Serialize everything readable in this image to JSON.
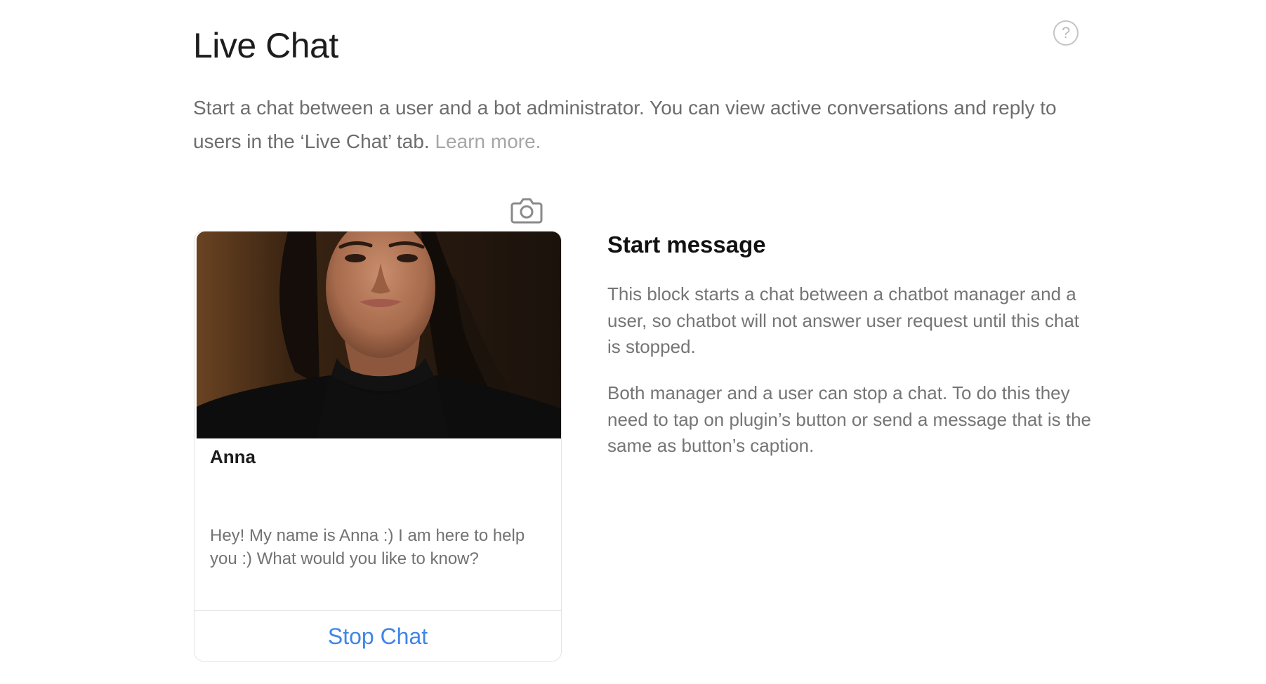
{
  "header": {
    "title": "Live Chat",
    "help_icon": "question-circle-icon",
    "help_glyph": "?"
  },
  "intro": {
    "text": "Start a chat between a user and a bot administrator. You can view active conversations and reply to users in the ‘Live Chat’ tab. ",
    "learn_more": "Learn more."
  },
  "card": {
    "camera_icon": "camera-icon",
    "image": "portrait-photo",
    "name": "Anna",
    "message": "Hey! My name is Anna :) I am here to help you :) What would you like to know?",
    "button_label": "Stop Chat"
  },
  "side": {
    "title": "Start message",
    "paragraph1": "This block starts a chat between a chatbot manager and a user, so chatbot will not answer user request until this chat is stopped.",
    "paragraph2": "Both manager and a user can stop a chat. To do this they need to tap on plugin’s button or send a message that is the same as button’s caption."
  },
  "colors": {
    "accent": "#3f86e6",
    "body_text": "#6d6d6d",
    "muted_link": "#a6a6a6",
    "border": "#e3e3e3"
  }
}
